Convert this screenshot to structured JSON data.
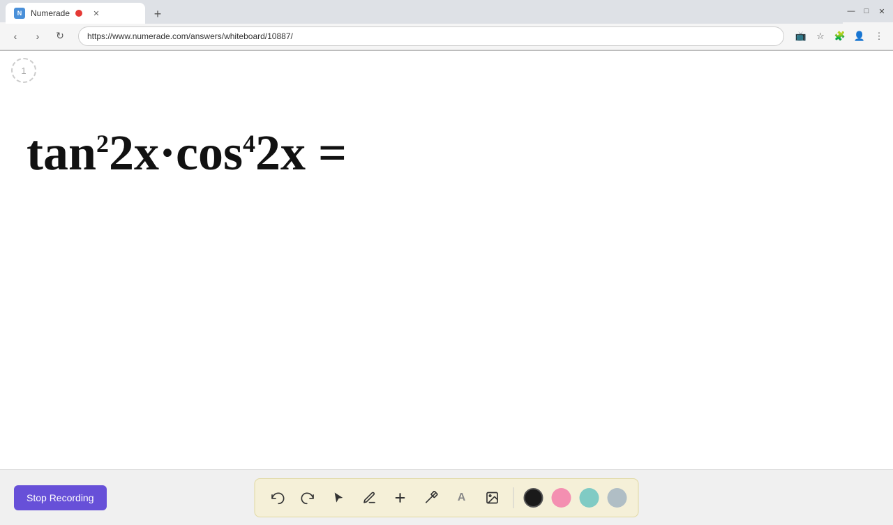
{
  "browser": {
    "tab_title": "Numerade",
    "tab_favicon_text": "N",
    "url": "https://www.numerade.com/answers/whiteboard/10887/",
    "new_tab_label": "+",
    "nav": {
      "back": "‹",
      "forward": "›",
      "reload": "↺"
    },
    "window_controls": {
      "minimize": "—",
      "maximize": "□",
      "close": "✕"
    }
  },
  "whiteboard": {
    "step_number": "1",
    "math_expression": "tan²2x·cos⁴2x ="
  },
  "toolbar": {
    "stop_recording_label": "Stop Recording",
    "tools": [
      {
        "name": "undo",
        "symbol": "↺",
        "label": "Undo"
      },
      {
        "name": "redo",
        "symbol": "↻",
        "label": "Redo"
      },
      {
        "name": "select",
        "symbol": "▷",
        "label": "Select"
      },
      {
        "name": "pen",
        "symbol": "✏",
        "label": "Pen"
      },
      {
        "name": "add",
        "symbol": "+",
        "label": "Add"
      },
      {
        "name": "highlighter",
        "symbol": "/",
        "label": "Highlighter"
      },
      {
        "name": "text",
        "symbol": "A",
        "label": "Text"
      },
      {
        "name": "image",
        "symbol": "🖼",
        "label": "Image"
      }
    ],
    "colors": [
      {
        "name": "black",
        "hex": "#1a1a1a"
      },
      {
        "name": "pink",
        "hex": "#f48fb1"
      },
      {
        "name": "green",
        "hex": "#80cbc4"
      },
      {
        "name": "gray",
        "hex": "#b0bec5"
      }
    ]
  }
}
